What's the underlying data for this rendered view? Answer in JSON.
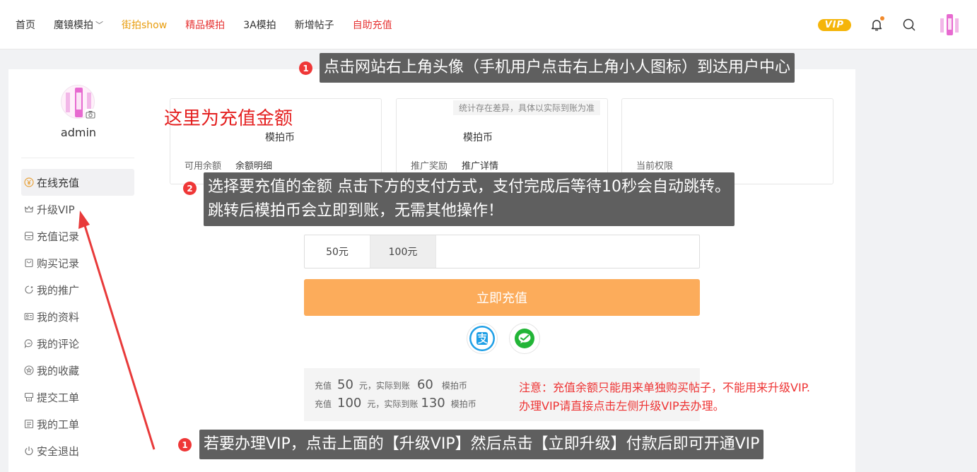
{
  "nav": {
    "items": [
      {
        "label": "首页",
        "style": "normal"
      },
      {
        "label": "魔镜模拍",
        "style": "normal",
        "has_dropdown": true
      },
      {
        "label": "街拍show",
        "style": "orange"
      },
      {
        "label": "精品模拍",
        "style": "red"
      },
      {
        "label": "3A模拍",
        "style": "normal"
      },
      {
        "label": "新增帖子",
        "style": "normal"
      },
      {
        "label": "自助充值",
        "style": "red"
      }
    ],
    "vip_badge": "VIP"
  },
  "sidebar": {
    "username": "admin",
    "items": [
      {
        "label": "在线充值",
        "icon": "yen-circle-icon",
        "active": true
      },
      {
        "label": "升级VIP",
        "icon": "crown-icon"
      },
      {
        "label": "充值记录",
        "icon": "record-icon"
      },
      {
        "label": "购买记录",
        "icon": "bag-icon"
      },
      {
        "label": "我的推广",
        "icon": "promote-icon"
      },
      {
        "label": "我的资料",
        "icon": "profile-card-icon"
      },
      {
        "label": "我的评论",
        "icon": "comment-icon"
      },
      {
        "label": "我的收藏",
        "icon": "star-icon"
      },
      {
        "label": "提交工单",
        "icon": "ticket-icon"
      },
      {
        "label": "我的工单",
        "icon": "list-icon"
      },
      {
        "label": "安全退出",
        "icon": "power-icon"
      }
    ]
  },
  "cards": {
    "balance": {
      "unit": "模拍币",
      "label": "可用余额",
      "link": "余额明细"
    },
    "reward": {
      "unit": "模拍币",
      "label": "推广奖励",
      "link": "推广详情",
      "note": "统计存在差异，具体以实际到账为准"
    },
    "permission": {
      "label": "当前权限"
    }
  },
  "recharge": {
    "options": [
      "50元",
      "100元"
    ],
    "selected_index": 1,
    "submit_label": "立即充值",
    "payment_methods": [
      "alipay",
      "wechat"
    ]
  },
  "rates": [
    {
      "prefix": "充值",
      "amount": "50",
      "mid": "元，实际到账",
      "coins": "60",
      "unit": "模拍币"
    },
    {
      "prefix": "充值",
      "amount": "100",
      "mid": "元，实际到账",
      "coins": "130",
      "unit": "模拍币"
    }
  ],
  "notice": {
    "line1": "注意：充值余额只能用来单独购买帖子，不能用来升级VIP.",
    "line2": "办理VIP请直接点击左侧升级VIP去办理。"
  },
  "annotations": {
    "step1_badge": "1",
    "step1_text": "点击网站右上角头像（手机用户点击右上角小人图标）到达用户中心",
    "amount_label": "这里为充值金额",
    "step2_badge": "2",
    "step2_line1": "选择要充值的金额 点击下方的支付方式，支付完成后等待10秒会自动跳转。",
    "step2_line2": "跳转后模拍币会立即到账，无需其他操作！",
    "step3_badge": "1",
    "step3_text": "若要办理VIP，点击上面的【升级VIP】然后点击【立即升级】付款后即可开通VIP"
  }
}
